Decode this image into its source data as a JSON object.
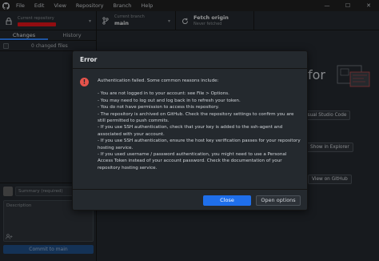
{
  "menubar": {
    "items": [
      "File",
      "Edit",
      "View",
      "Repository",
      "Branch",
      "Help"
    ]
  },
  "window_controls": {
    "minimize": "—",
    "maximize": "☐",
    "close": "✕"
  },
  "toolbar": {
    "repository": {
      "label": "Current repository",
      "value": "redacted"
    },
    "branch": {
      "label": "Current branch",
      "value": "main"
    },
    "fetch": {
      "label": "Fetch origin",
      "sub": "Never fetched"
    }
  },
  "sidebar": {
    "tabs": [
      "Changes",
      "History"
    ],
    "changed_files": "0 changed files",
    "summary_placeholder": "Summary (required)",
    "description_placeholder": "Description",
    "commit_button": "Commit to main"
  },
  "main": {
    "illustration_caption": "for",
    "buttons": {
      "open_editor": "isual Studio Code",
      "show_explorer": "Show in Explorer",
      "view_github": "View on GitHub"
    }
  },
  "dialog": {
    "title": "Error",
    "intro": "Authentication failed. Some common reasons include:",
    "reasons": [
      "- You are not logged in to your account: see File > Options.",
      "- You may need to log out and log back in to refresh your token.",
      "- You do not have permission to access this repository.",
      "- The repository is archived on GitHub. Check the repository settings to confirm you are still permitted to push commits.",
      "- If you use SSH authentication, check that your key is added to the ssh-agent and associated with your account.",
      "- If you use SSH authentication, ensure the host key verification passes for your repository hosting service.",
      "- If you used username / password authentication, you might need to use a Personal Access Token instead of your account password. Check the documentation of your repository hosting service."
    ],
    "close_button": "Close",
    "open_options_button": "Open options"
  },
  "colors": {
    "accent": "#1f6feb",
    "error": "#e5534b",
    "redacted": "#e0141b"
  }
}
